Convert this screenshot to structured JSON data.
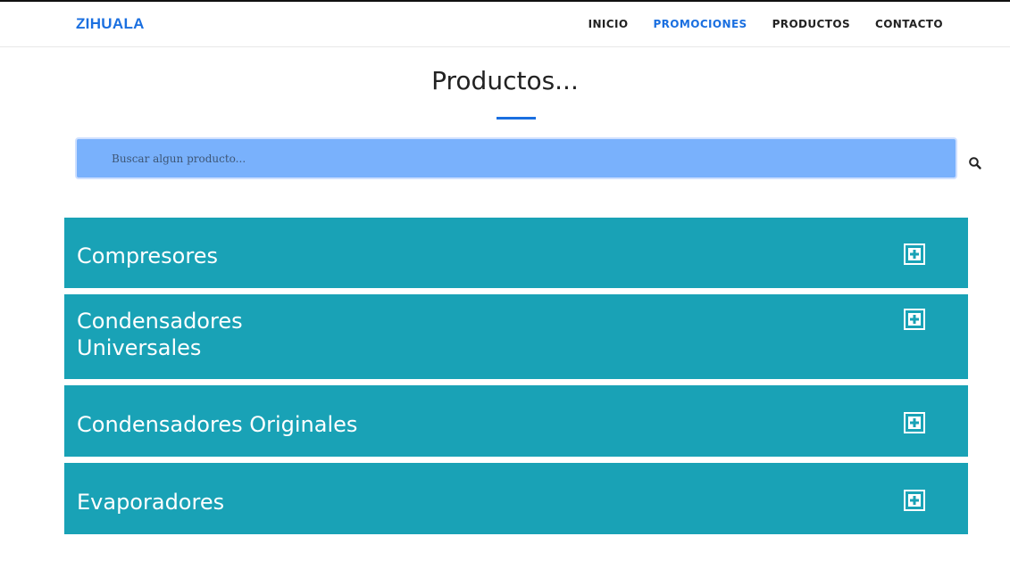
{
  "navbar": {
    "brand": "ZIHUALA",
    "items": [
      {
        "label": "INICIO",
        "active": false
      },
      {
        "label": "PROMOCIONES",
        "active": true
      },
      {
        "label": "PRODUCTOS",
        "active": false
      },
      {
        "label": "CONTACTO",
        "active": false
      }
    ]
  },
  "main": {
    "title": "Productos...",
    "search": {
      "placeholder": "Buscar algun producto...",
      "value": "",
      "icon": "search-icon"
    },
    "categories": [
      {
        "label": "Compresores",
        "icon": "plus-square-icon"
      },
      {
        "label": "Condensadores Universales",
        "icon": "plus-square-icon"
      },
      {
        "label": "Condensadores Originales",
        "icon": "plus-square-icon"
      },
      {
        "label": "Evaporadores",
        "icon": "plus-square-icon"
      }
    ]
  },
  "colors": {
    "accent": "#1a6fe0",
    "category_bg": "#19a2b6",
    "search_bg": "#79b1fc"
  }
}
